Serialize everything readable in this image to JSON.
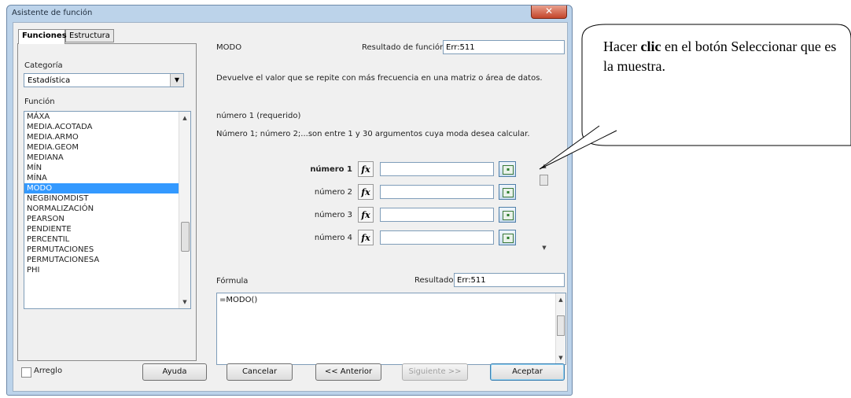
{
  "window": {
    "title": "Asistente de función",
    "close_glyph": "✕"
  },
  "tabs": {
    "funciones": "Funciones",
    "estructura": "Estructura"
  },
  "left": {
    "categoria_label": "Categoría",
    "categoria_value": "Estadística",
    "funcion_label": "Función",
    "functions": [
      "MÁXA",
      "MEDIA.ACOTADA",
      "MEDIA.ARMO",
      "MEDIA.GEOM",
      "MEDIANA",
      "MÍN",
      "MÍNA",
      "MODO",
      "NEGBINOMDIST",
      "NORMALIZACIÓN",
      "PEARSON",
      "PENDIENTE",
      "PERCENTIL",
      "PERMUTACIONES",
      "PERMUTACIONESA",
      "PHI"
    ],
    "selected_function": "MODO",
    "arreglo_label": "Arreglo"
  },
  "right": {
    "func_name": "MODO",
    "resultado_funcion_label": "Resultado de función",
    "resultado_funcion_value": "Err:511",
    "description": "Devuelve el valor que se repite con más frecuencia en una matriz o área de datos.",
    "param_title": "número 1 (requerido)",
    "param_desc": "Número 1; número 2;...son entre 1 y 30 argumentos cuya moda desea calcular.",
    "args": [
      {
        "label": "número 1",
        "value": ""
      },
      {
        "label": "número 2",
        "value": ""
      },
      {
        "label": "número 3",
        "value": ""
      },
      {
        "label": "número 4",
        "value": ""
      }
    ],
    "fx_glyph": "fx",
    "formula_label": "Fórmula",
    "resultado_label": "Resultado",
    "resultado_value": "Err:511",
    "formula_text": "=MODO()"
  },
  "buttons": {
    "ayuda": "Ayuda",
    "cancelar": "Cancelar",
    "anterior": "<< Anterior",
    "siguiente": "Siguiente >>",
    "aceptar": "Aceptar"
  },
  "callout": {
    "pre": "Hacer ",
    "bold": "clic",
    "post": " en el botón Seleccionar que es la muestra."
  }
}
